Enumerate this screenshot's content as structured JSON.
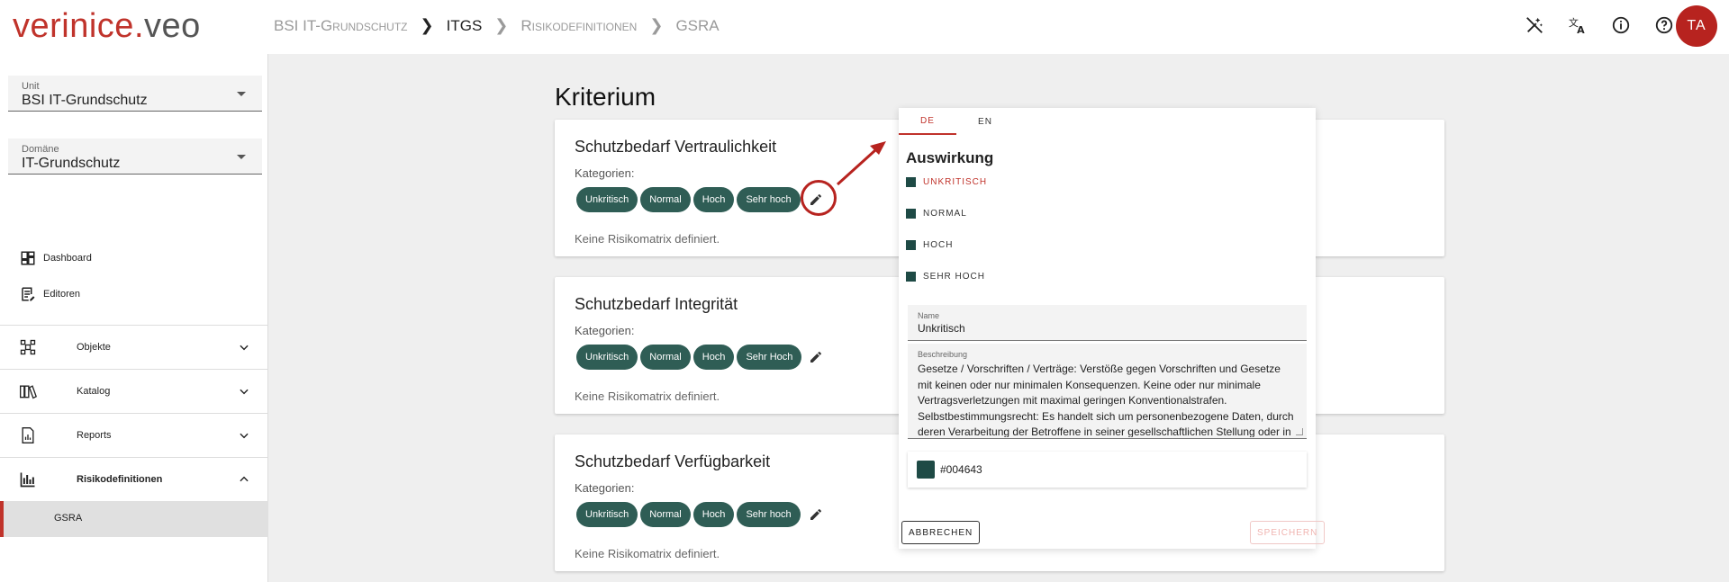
{
  "header": {
    "logo_part1": "verinice",
    "logo_dot": ".",
    "logo_part2": "veo",
    "breadcrumb": [
      "BSI IT-Grundschutz",
      "ITGS",
      "Risikodefinitionen",
      "GSRA"
    ],
    "avatar_initials": "TA",
    "icons": [
      "magic-wand-off-icon",
      "translate-icon",
      "info-icon",
      "help-icon"
    ]
  },
  "sidebar": {
    "unit": {
      "label": "Unit",
      "value": "BSI IT-Grundschutz"
    },
    "domain": {
      "label": "Domäne",
      "value": "IT-Grundschutz"
    },
    "links": [
      {
        "label": "Dashboard",
        "icon": "dashboard-icon"
      },
      {
        "label": "Editoren",
        "icon": "editor-icon"
      }
    ],
    "groups": [
      {
        "label": "Objekte",
        "icon": "objects-icon",
        "expanded": false
      },
      {
        "label": "Katalog",
        "icon": "catalog-icon",
        "expanded": false
      },
      {
        "label": "Reports",
        "icon": "reports-icon",
        "expanded": false
      },
      {
        "label": "Risikodefinitionen",
        "icon": "chart-icon",
        "expanded": true
      }
    ],
    "active_sub": "GSRA"
  },
  "main": {
    "title": "Kriterium",
    "cards": [
      {
        "title": "Schutzbedarf Vertraulichkeit",
        "categories_label": "Kategorien:",
        "chips": [
          "Unkritisch",
          "Normal",
          "Hoch",
          "Sehr hoch"
        ],
        "note": "Keine Risikomatrix definiert."
      },
      {
        "title": "Schutzbedarf Integrität",
        "categories_label": "Kategorien:",
        "chips": [
          "Unkritisch",
          "Normal",
          "Hoch",
          "Sehr Hoch"
        ],
        "note": "Keine Risikomatrix definiert."
      },
      {
        "title": "Schutzbedarf Verfügbarkeit",
        "categories_label": "Kategorien:",
        "chips": [
          "Unkritisch",
          "Normal",
          "Hoch",
          "Sehr hoch"
        ],
        "note": "Keine Risikomatrix definiert."
      }
    ]
  },
  "dialog": {
    "tabs": [
      "DE",
      "EN"
    ],
    "active_tab": "DE",
    "title": "Auswirkung",
    "categories": [
      "UNKRITISCH",
      "NORMAL",
      "HOCH",
      "SEHR HOCH"
    ],
    "selected_category": "UNKRITISCH",
    "name_label": "Name",
    "name_value": "Unkritisch",
    "description_label": "Beschreibung",
    "description_value": "Gesetze / Vorschriften / Verträge: Verstöße gegen Vorschriften und Gesetze mit keinen oder nur minimalen Konsequenzen. Keine oder nur minimale Vertragsverletzungen mit maximal geringen Konventionalstrafen. Selbstbestimmungsrecht: Es handelt sich um personenbezogene Daten, durch deren Verarbeitung der Betroffene in seiner gesellschaftlichen Stellung oder in",
    "color_value": "#004643",
    "cancel_label": "ABBRECHEN",
    "save_label": "SPEICHERN"
  },
  "colors": {
    "brand": "#c0332b",
    "chip": "#2f5d55",
    "category": "#004643"
  }
}
